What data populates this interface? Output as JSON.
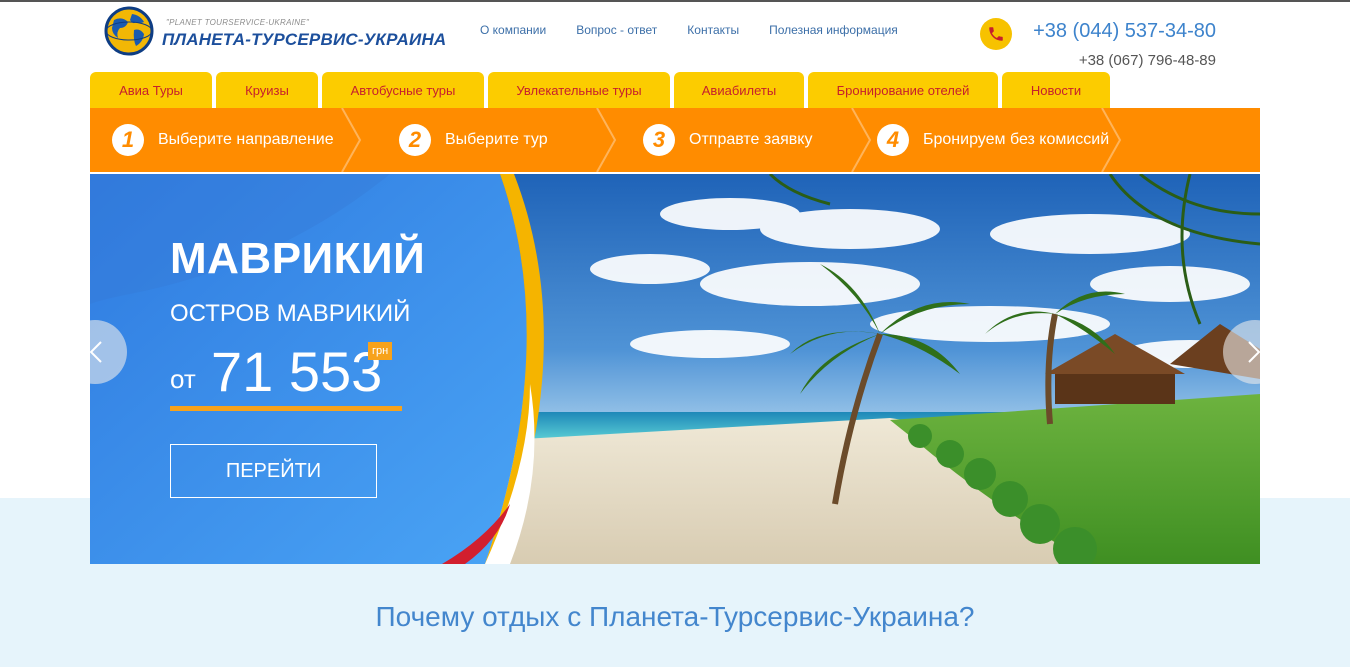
{
  "logo": {
    "tagline": "\"PLANET TOURSERVICE-UKRAINE\"",
    "name": "ПЛАНЕТА-ТУРСЕРВИС-УКРАИНА"
  },
  "topnav": [
    {
      "label": "О компании"
    },
    {
      "label": "Вопрос - ответ"
    },
    {
      "label": "Контакты"
    },
    {
      "label": "Полезная информация"
    }
  ],
  "contacts": {
    "phone_main": "+38 (044) 537-34-80",
    "phone_secondary": "+38 (067) 796-48-89",
    "icon": "phone-icon"
  },
  "tabs": [
    {
      "label": "Авиа Туры"
    },
    {
      "label": "Круизы"
    },
    {
      "label": "Автобусные туры"
    },
    {
      "label": "Увлекательные туры"
    },
    {
      "label": "Авиабилеты"
    },
    {
      "label": "Бронирование отелей"
    },
    {
      "label": "Новости"
    }
  ],
  "steps": [
    {
      "num": "1",
      "label": "Выберите направление"
    },
    {
      "num": "2",
      "label": "Выберите тур"
    },
    {
      "num": "3",
      "label": "Отправте заявку"
    },
    {
      "num": "4",
      "label": "Бронируем без комиссий"
    }
  ],
  "hero": {
    "title": "МАВРИКИЙ",
    "subtitle": "ОСТРОВ МАВРИКИЙ",
    "price_prefix": "от",
    "price": "71 553",
    "currency": "грн",
    "button": "ПЕРЕЙТИ"
  },
  "section": {
    "title": "Почему отдых с Планета-Турсервис-Украина?"
  },
  "colors": {
    "tab_yellow": "#fccc00",
    "tab_text_red": "#c6202c",
    "steps_orange": "#ff8c00",
    "hero_blue": "#3d8ee8",
    "price_accent": "#f7a21b",
    "link_blue": "#3c6fa8",
    "section_title_blue": "#4386cd"
  }
}
